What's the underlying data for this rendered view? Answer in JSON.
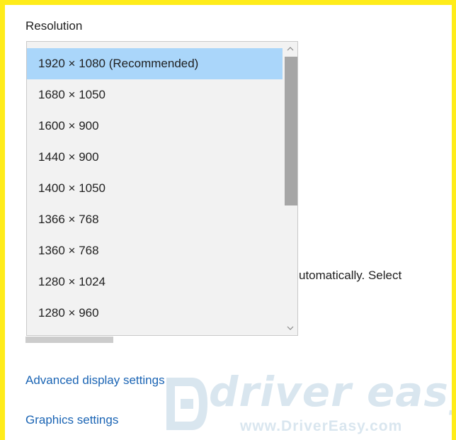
{
  "resolution": {
    "label": "Resolution",
    "options": [
      "1920 × 1080 (Recommended)",
      "1680 × 1050",
      "1600 × 900",
      "1440 × 900",
      "1400 × 1050",
      "1366 × 768",
      "1360 × 768",
      "1280 × 1024",
      "1280 × 960"
    ],
    "selected_index": 0
  },
  "background": {
    "partial_text": "utomatically. Select"
  },
  "links": {
    "advanced": "Advanced display settings",
    "graphics": "Graphics settings"
  },
  "watermark": {
    "brand": "driver easy",
    "url": "www.DriverEasy.com"
  },
  "icons": {
    "scroll_up": "chevron-up-icon",
    "scroll_down": "chevron-down-icon",
    "watermark_logo": "driver-easy-logo-icon"
  },
  "colors": {
    "frame": "#ffec1a",
    "selected_bg": "#aad6fa",
    "link": "#1a64b4",
    "dropdown_bg": "#f2f2f2",
    "scroll_thumb": "#a6a6a6"
  }
}
